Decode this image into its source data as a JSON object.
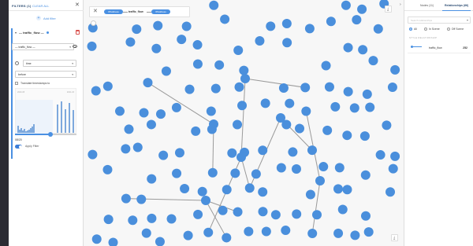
{
  "filters": {
    "title": "FILTERS (1)",
    "clear_all": "CLEAR ALL",
    "add_filter": "Add filter",
    "card": {
      "name": "— traffic_flow —",
      "type_select": "— traffic_flow —",
      "property_select": "time",
      "operator_select": "before",
      "translate_label": "Translate timestamps to",
      "histogram_left_label": "2020-08",
      "histogram_right_label": "2021-03",
      "slider_value": 0.58,
      "date_value": "08/20",
      "apply_label": "Apply Filter",
      "histogram_bars": [
        0.22,
        0.1,
        0.15,
        0.08,
        0.12,
        0.05,
        0.06,
        0.1,
        0.14,
        0.18,
        0.25,
        0.85,
        0.95,
        0.72,
        0.9,
        0.7
      ]
    }
  },
  "query": {
    "node_a": "IPAddress",
    "relationship": "traffic_flow",
    "node_b": "IPAddress"
  },
  "right_panel": {
    "tabs": [
      {
        "label": "Nodes (11)",
        "active": false
      },
      {
        "label": "Relationships (66)",
        "active": true
      }
    ],
    "search_placeholder": "Search relationships",
    "radio_options": [
      {
        "label": "All",
        "selected": true
      },
      {
        "label": "In Scene",
        "selected": false
      },
      {
        "label": "Off Scene",
        "selected": false
      }
    ],
    "column_header": "STYLE  RELATIONSHIP",
    "rows": [
      {
        "name": "traffic_flow",
        "count": "252"
      }
    ]
  },
  "graph": {
    "node_color": "#4a8fdc",
    "edge_color": "#9a9a9a"
  },
  "colors": {
    "accent": "#4a90e2",
    "rail": "#2b2b33"
  }
}
